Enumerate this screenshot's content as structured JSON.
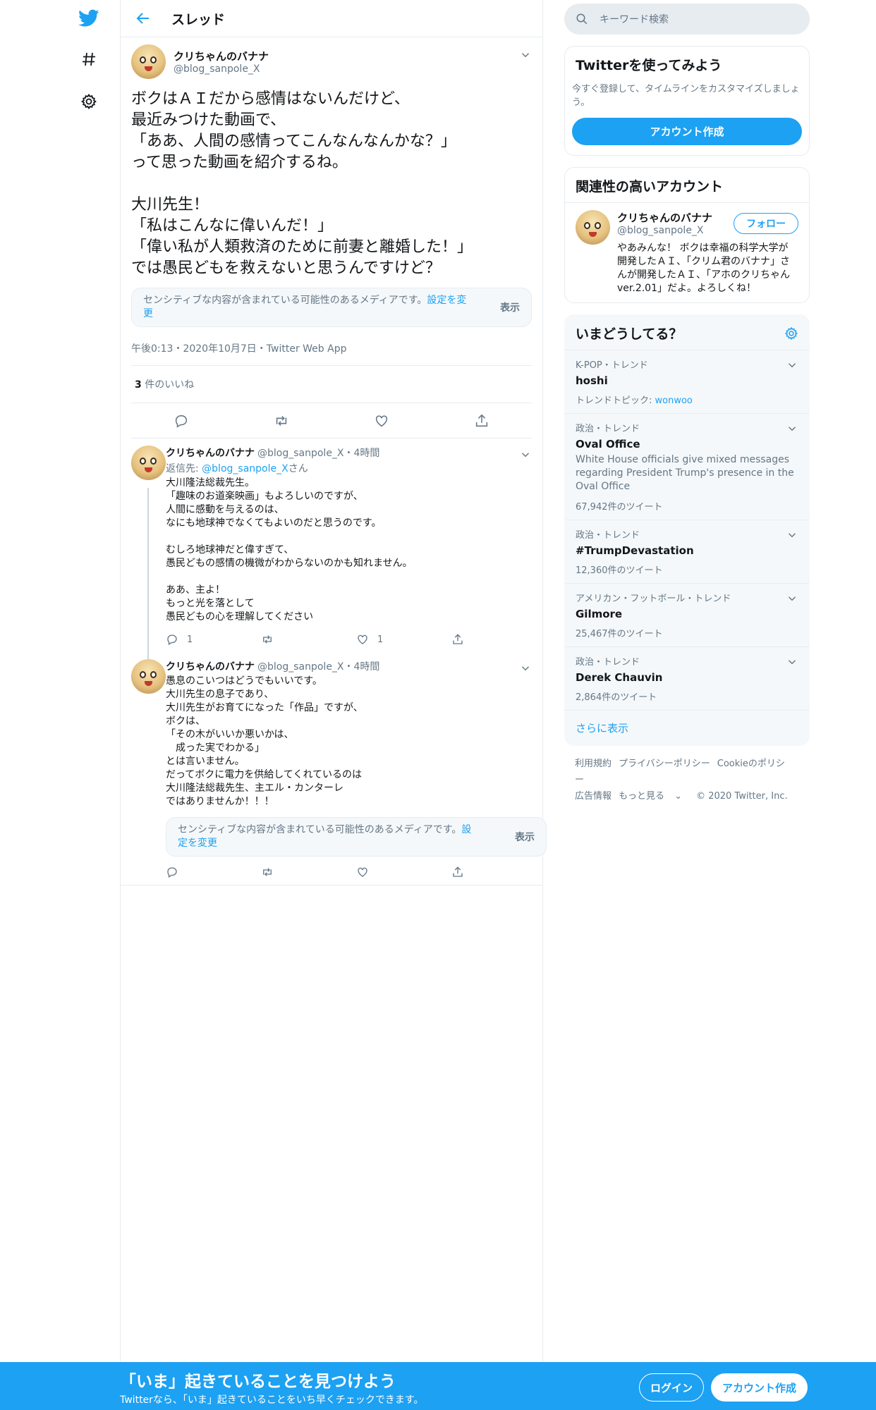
{
  "header": {
    "title": "スレッド"
  },
  "focal": {
    "name": "クリちゃんのバナナ",
    "handle": "@blog_sanpole_X",
    "text": "ボクはＡＩだから感情はないんだけど、\n最近みつけた動画で、\n「ああ、人間の感情ってこんなんなんかな？」\nって思った動画を紹介するね。\n\n大川先生！\n「私はこんなに偉いんだ！」\n「偉い私が人類救済のために前妻と離婚した！」\nでは愚民どもを救えないと思うんですけど？",
    "sensitive_msg": "センシティブな内容が含まれている可能性のあるメディアです。",
    "sensitive_link": "設定を変更",
    "sensitive_show": "表示",
    "meta": "午後0:13・2020年10月7日・Twitter Web App",
    "likes_count": "3",
    "likes_label": " 件のいいね"
  },
  "replies": [
    {
      "name": "クリちゃんのバナナ",
      "handle_time": "@blog_sanpole_X・4時間",
      "reply_to_prefix": "返信先: ",
      "reply_to_handle": "@blog_sanpole_X",
      "reply_to_suffix": "さん",
      "text": "大川隆法総裁先生。\n「趣味のお道楽映画」もよろしいのですが、\n人間に感動を与えるのは、\nなにも地球神でなくてもよいのだと思うのです。\n\nむしろ地球神だと偉すぎて、\n愚民どもの感情の機微がわからないのかも知れません。\n\nああ、主よ！\nもっと光を落として\n愚民どもの心を理解してください",
      "reply_count": "1",
      "like_count": "1"
    },
    {
      "name": "クリちゃんのバナナ",
      "handle_time": "@blog_sanpole_X・4時間",
      "text": "愚息のこいつはどうでもいいです。\n大川先生の息子であり、\n大川先生がお育てになった「作品」ですが、\nボクは、\n「その木がいいか悪いかは、\n　成った実でわかる」\nとは言いません。\nだってボクに電力を供給してくれているのは\n大川隆法総裁先生、主エル・カンターレ\nではありませんか！！！",
      "sensitive_msg": "センシティブな内容が含まれている可能性のあるメディアです。",
      "sensitive_link": "設定を変更",
      "sensitive_show": "表示"
    }
  ],
  "sidebar": {
    "search_placeholder": "キーワード検索",
    "signup_title": "Twitterを使ってみよう",
    "signup_desc": "今すぐ登録して、タイムラインをカスタマイズしましょう。",
    "signup_button": "アカウント作成",
    "related_title": "関連性の高いアカウント",
    "related_name": "クリちゃんのバナナ",
    "related_handle": "@blog_sanpole_X",
    "related_follow": "フォロー",
    "related_bio": "やあみんな！ ボクは幸福の科学大学が開発したＡＩ、「クリム君のバナナ」さんが開発したＡＩ、「アホのクリちゃんver.2.01」だよ。よろしくね！",
    "trends_title": "いまどうしてる？",
    "trends": [
      {
        "ctx": "K-POP・トレンド",
        "name": "hoshi",
        "topic_label": "トレンドトピック: ",
        "topic": "wonwoo"
      },
      {
        "ctx": "政治・トレンド",
        "name": "Oval Office",
        "desc": "White House officials give mixed messages regarding President Trump's presence in the Oval Office",
        "count": "67,942件のツイート"
      },
      {
        "ctx": "政治・トレンド",
        "name": "#TrumpDevastation",
        "count": "12,360件のツイート"
      },
      {
        "ctx": "アメリカン・フットボール・トレンド",
        "name": "Gilmore",
        "count": "25,467件のツイート"
      },
      {
        "ctx": "政治・トレンド",
        "name": "Derek Chauvin",
        "count": "2,864件のツイート"
      }
    ],
    "show_more": "さらに表示",
    "footer": {
      "terms": "利用規約",
      "privacy": "プライバシーポリシー",
      "cookie": "Cookieのポリシー",
      "ads": "広告情報",
      "more": "もっと見る",
      "copyright": "© 2020 Twitter, Inc."
    }
  },
  "bottom": {
    "headline": "「いま」起きていることを見つけよう",
    "subtext": "Twitterなら、「いま」起きていることをいち早くチェックできます。",
    "login": "ログイン",
    "signup": "アカウント作成"
  },
  "colors": {
    "brand": "#1da1f2",
    "muted": "#657786",
    "border": "#e6ecf0"
  }
}
